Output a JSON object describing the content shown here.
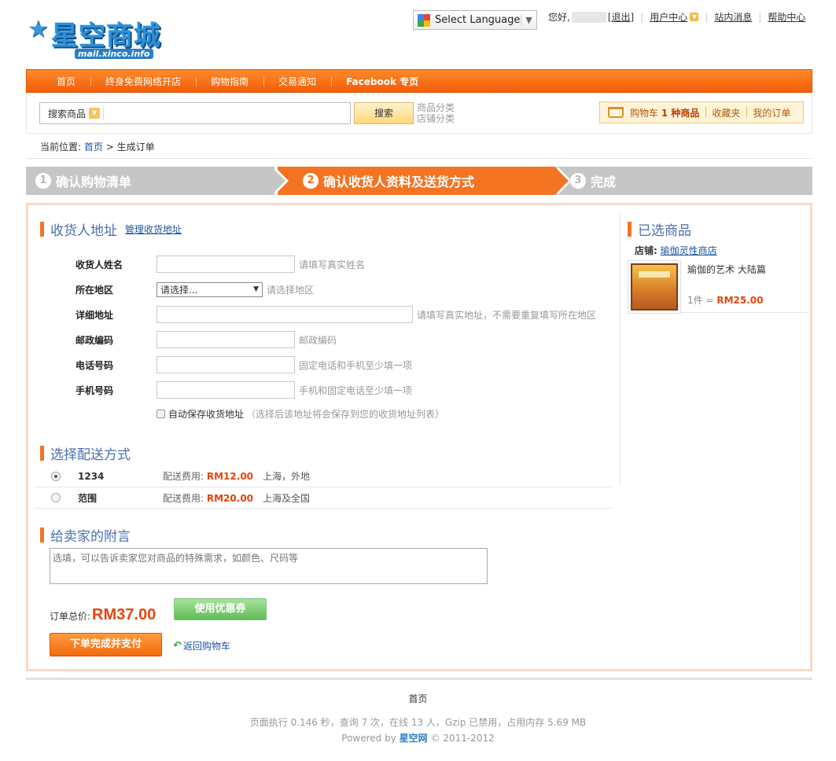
{
  "header": {
    "logo_text": "星空商城",
    "logo_url": "mail.xinco.info",
    "language_label": "Select Language",
    "greeting": "您好,",
    "logout": "[退出]",
    "user_center": "用户中心",
    "messages": "站内消息",
    "help": "帮助中心"
  },
  "nav": {
    "items": [
      "首页",
      "终身免费网络开店",
      "购物指南",
      "交易通知",
      "Facebook 专页"
    ]
  },
  "search": {
    "category": "搜索商品",
    "placeholder": "",
    "button": "搜索",
    "link_goods": "商品分类",
    "link_shops": "店铺分类"
  },
  "cart": {
    "label_prefix": "购物车",
    "count_text": "1 种商品",
    "favorites": "收藏夹",
    "orders": "我的订单"
  },
  "breadcrumb": {
    "prefix": "当前位置:",
    "home": "首页",
    "sep": ">",
    "current": "生成订单"
  },
  "steps": [
    {
      "num": "1",
      "label": "确认购物清单"
    },
    {
      "num": "2",
      "label": "确认收货人资料及送货方式"
    },
    {
      "num": "3",
      "label": "完成"
    }
  ],
  "address": {
    "title": "收货人地址",
    "manage_link": "管理收货地址",
    "fields": {
      "name": {
        "label": "收货人姓名",
        "hint": "请填写真实姓名",
        "value": ""
      },
      "region": {
        "label": "所在地区",
        "selected": "请选择...",
        "hint": "请选择地区"
      },
      "address": {
        "label": "详细地址",
        "hint": "请填写真实地址，不需要重复填写所在地区",
        "value": ""
      },
      "zip": {
        "label": "邮政编码",
        "hint": "邮政编码",
        "value": ""
      },
      "phone": {
        "label": "电话号码",
        "hint": "固定电话和手机至少填一项",
        "value": ""
      },
      "mobile": {
        "label": "手机号码",
        "hint": "手机和固定电话至少填一项",
        "value": ""
      }
    },
    "autosave_label": "自动保存收货地址",
    "autosave_hint": "（选择后该地址将会保存到您的收货地址列表）"
  },
  "shipping": {
    "title": "选择配送方式",
    "fee_label": "配送费用:",
    "options": [
      {
        "name": "1234",
        "fee": "RM12.00",
        "area": "上海，外地",
        "selected": true
      },
      {
        "name": "范围",
        "fee": "RM20.00",
        "area": "上海及全国",
        "selected": false
      }
    ]
  },
  "memo": {
    "title": "给卖家的附言",
    "placeholder": "选填，可以告诉卖家您对商品的特殊需求，如颜色、尺码等"
  },
  "order": {
    "total_label": "订单总价:",
    "total_value": "RM37.00",
    "coupon_button": "使用优惠券",
    "submit_button": "下单完成并支付",
    "back_link": "返回购物车"
  },
  "selected_goods": {
    "title": "已选商品",
    "shop_label": "店铺:",
    "shop_name": "瑜伽灵性商店",
    "product_name": "瑜伽的艺术 大陆篇",
    "qty_text": "1件 =",
    "price": "RM25.00"
  },
  "footer": {
    "home": "首页",
    "stats": "页面执行 0.146 秒，查询 7 次，在线 13 人，Gzip 已禁用，占用内存 5.69 MB",
    "powered_prefix": "Powered by",
    "powered_brand": "星空网",
    "powered_suffix": "© 2011-2012"
  },
  "colors": {
    "accent": "#f47422",
    "link": "#1a55a2",
    "price": "#e5450e",
    "title": "#4a6fb0"
  }
}
